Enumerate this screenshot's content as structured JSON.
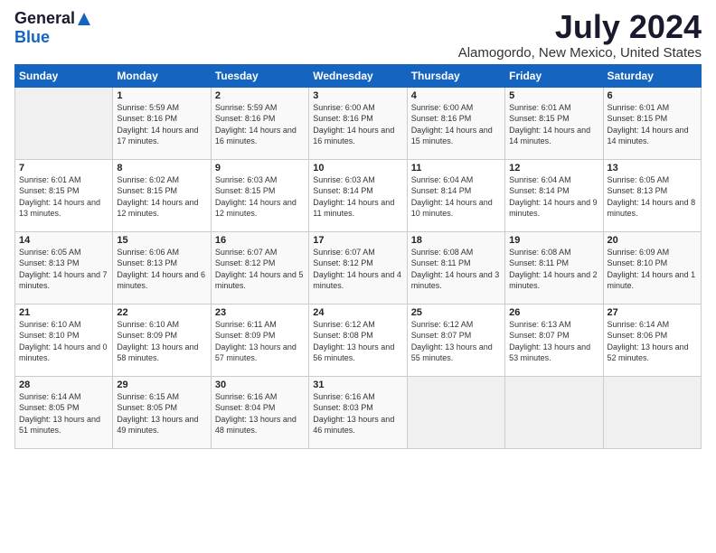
{
  "header": {
    "logo_general": "General",
    "logo_blue": "Blue",
    "month_year": "July 2024",
    "location": "Alamogordo, New Mexico, United States"
  },
  "days_of_week": [
    "Sunday",
    "Monday",
    "Tuesday",
    "Wednesday",
    "Thursday",
    "Friday",
    "Saturday"
  ],
  "weeks": [
    [
      {
        "day": "",
        "sunrise": "",
        "sunset": "",
        "daylight": "",
        "empty": true
      },
      {
        "day": "1",
        "sunrise": "Sunrise: 5:59 AM",
        "sunset": "Sunset: 8:16 PM",
        "daylight": "Daylight: 14 hours and 17 minutes."
      },
      {
        "day": "2",
        "sunrise": "Sunrise: 5:59 AM",
        "sunset": "Sunset: 8:16 PM",
        "daylight": "Daylight: 14 hours and 16 minutes."
      },
      {
        "day": "3",
        "sunrise": "Sunrise: 6:00 AM",
        "sunset": "Sunset: 8:16 PM",
        "daylight": "Daylight: 14 hours and 16 minutes."
      },
      {
        "day": "4",
        "sunrise": "Sunrise: 6:00 AM",
        "sunset": "Sunset: 8:16 PM",
        "daylight": "Daylight: 14 hours and 15 minutes."
      },
      {
        "day": "5",
        "sunrise": "Sunrise: 6:01 AM",
        "sunset": "Sunset: 8:15 PM",
        "daylight": "Daylight: 14 hours and 14 minutes."
      },
      {
        "day": "6",
        "sunrise": "Sunrise: 6:01 AM",
        "sunset": "Sunset: 8:15 PM",
        "daylight": "Daylight: 14 hours and 14 minutes."
      }
    ],
    [
      {
        "day": "7",
        "sunrise": "Sunrise: 6:01 AM",
        "sunset": "Sunset: 8:15 PM",
        "daylight": "Daylight: 14 hours and 13 minutes."
      },
      {
        "day": "8",
        "sunrise": "Sunrise: 6:02 AM",
        "sunset": "Sunset: 8:15 PM",
        "daylight": "Daylight: 14 hours and 12 minutes."
      },
      {
        "day": "9",
        "sunrise": "Sunrise: 6:03 AM",
        "sunset": "Sunset: 8:15 PM",
        "daylight": "Daylight: 14 hours and 12 minutes."
      },
      {
        "day": "10",
        "sunrise": "Sunrise: 6:03 AM",
        "sunset": "Sunset: 8:14 PM",
        "daylight": "Daylight: 14 hours and 11 minutes."
      },
      {
        "day": "11",
        "sunrise": "Sunrise: 6:04 AM",
        "sunset": "Sunset: 8:14 PM",
        "daylight": "Daylight: 14 hours and 10 minutes."
      },
      {
        "day": "12",
        "sunrise": "Sunrise: 6:04 AM",
        "sunset": "Sunset: 8:14 PM",
        "daylight": "Daylight: 14 hours and 9 minutes."
      },
      {
        "day": "13",
        "sunrise": "Sunrise: 6:05 AM",
        "sunset": "Sunset: 8:13 PM",
        "daylight": "Daylight: 14 hours and 8 minutes."
      }
    ],
    [
      {
        "day": "14",
        "sunrise": "Sunrise: 6:05 AM",
        "sunset": "Sunset: 8:13 PM",
        "daylight": "Daylight: 14 hours and 7 minutes."
      },
      {
        "day": "15",
        "sunrise": "Sunrise: 6:06 AM",
        "sunset": "Sunset: 8:13 PM",
        "daylight": "Daylight: 14 hours and 6 minutes."
      },
      {
        "day": "16",
        "sunrise": "Sunrise: 6:07 AM",
        "sunset": "Sunset: 8:12 PM",
        "daylight": "Daylight: 14 hours and 5 minutes."
      },
      {
        "day": "17",
        "sunrise": "Sunrise: 6:07 AM",
        "sunset": "Sunset: 8:12 PM",
        "daylight": "Daylight: 14 hours and 4 minutes."
      },
      {
        "day": "18",
        "sunrise": "Sunrise: 6:08 AM",
        "sunset": "Sunset: 8:11 PM",
        "daylight": "Daylight: 14 hours and 3 minutes."
      },
      {
        "day": "19",
        "sunrise": "Sunrise: 6:08 AM",
        "sunset": "Sunset: 8:11 PM",
        "daylight": "Daylight: 14 hours and 2 minutes."
      },
      {
        "day": "20",
        "sunrise": "Sunrise: 6:09 AM",
        "sunset": "Sunset: 8:10 PM",
        "daylight": "Daylight: 14 hours and 1 minute."
      }
    ],
    [
      {
        "day": "21",
        "sunrise": "Sunrise: 6:10 AM",
        "sunset": "Sunset: 8:10 PM",
        "daylight": "Daylight: 14 hours and 0 minutes."
      },
      {
        "day": "22",
        "sunrise": "Sunrise: 6:10 AM",
        "sunset": "Sunset: 8:09 PM",
        "daylight": "Daylight: 13 hours and 58 minutes."
      },
      {
        "day": "23",
        "sunrise": "Sunrise: 6:11 AM",
        "sunset": "Sunset: 8:09 PM",
        "daylight": "Daylight: 13 hours and 57 minutes."
      },
      {
        "day": "24",
        "sunrise": "Sunrise: 6:12 AM",
        "sunset": "Sunset: 8:08 PM",
        "daylight": "Daylight: 13 hours and 56 minutes."
      },
      {
        "day": "25",
        "sunrise": "Sunrise: 6:12 AM",
        "sunset": "Sunset: 8:07 PM",
        "daylight": "Daylight: 13 hours and 55 minutes."
      },
      {
        "day": "26",
        "sunrise": "Sunrise: 6:13 AM",
        "sunset": "Sunset: 8:07 PM",
        "daylight": "Daylight: 13 hours and 53 minutes."
      },
      {
        "day": "27",
        "sunrise": "Sunrise: 6:14 AM",
        "sunset": "Sunset: 8:06 PM",
        "daylight": "Daylight: 13 hours and 52 minutes."
      }
    ],
    [
      {
        "day": "28",
        "sunrise": "Sunrise: 6:14 AM",
        "sunset": "Sunset: 8:05 PM",
        "daylight": "Daylight: 13 hours and 51 minutes."
      },
      {
        "day": "29",
        "sunrise": "Sunrise: 6:15 AM",
        "sunset": "Sunset: 8:05 PM",
        "daylight": "Daylight: 13 hours and 49 minutes."
      },
      {
        "day": "30",
        "sunrise": "Sunrise: 6:16 AM",
        "sunset": "Sunset: 8:04 PM",
        "daylight": "Daylight: 13 hours and 48 minutes."
      },
      {
        "day": "31",
        "sunrise": "Sunrise: 6:16 AM",
        "sunset": "Sunset: 8:03 PM",
        "daylight": "Daylight: 13 hours and 46 minutes."
      },
      {
        "day": "",
        "sunrise": "",
        "sunset": "",
        "daylight": "",
        "empty": true
      },
      {
        "day": "",
        "sunrise": "",
        "sunset": "",
        "daylight": "",
        "empty": true
      },
      {
        "day": "",
        "sunrise": "",
        "sunset": "",
        "daylight": "",
        "empty": true
      }
    ]
  ]
}
